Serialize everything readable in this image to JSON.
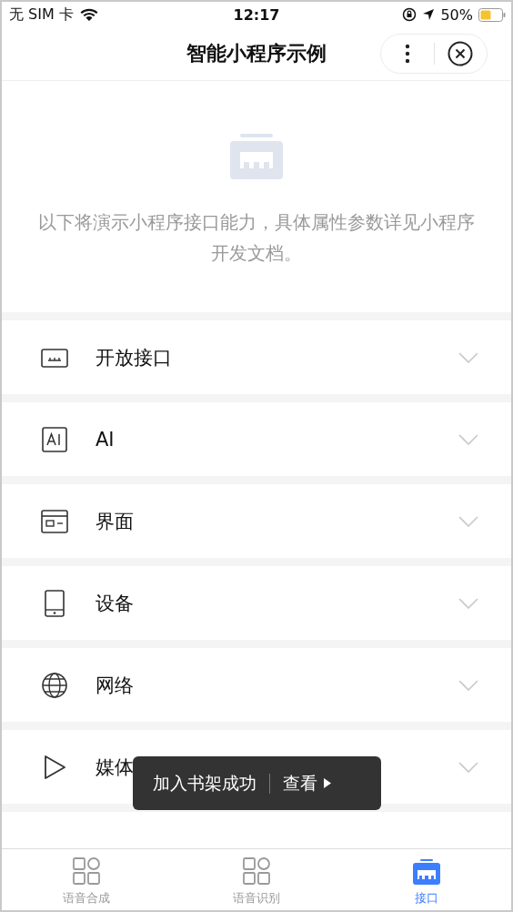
{
  "status_bar": {
    "carrier": "无 SIM 卡",
    "time": "12:17",
    "battery": "50%"
  },
  "nav": {
    "title": "智能小程序示例"
  },
  "intro": {
    "text": "以下将演示小程序接口能力，具体属性参数详见小程序开发文档。"
  },
  "sections": [
    {
      "label": "开放接口",
      "kind": "api",
      "expanded": false
    },
    {
      "label": "AI",
      "kind": "ai",
      "expanded": false
    },
    {
      "label": "界面",
      "kind": "ui",
      "expanded": false
    },
    {
      "label": "设备",
      "kind": "device",
      "expanded": false
    },
    {
      "label": "网络",
      "kind": "network",
      "expanded": false
    },
    {
      "label": "媒体",
      "kind": "media",
      "expanded": false
    }
  ],
  "toast": {
    "message": "加入书架成功",
    "action": "查看"
  },
  "tabs": [
    {
      "label": "语音合成",
      "kind": "grid",
      "selected": false
    },
    {
      "label": "语音识别",
      "kind": "grid",
      "selected": false
    },
    {
      "label": "接口",
      "kind": "api",
      "selected": true
    }
  ]
}
